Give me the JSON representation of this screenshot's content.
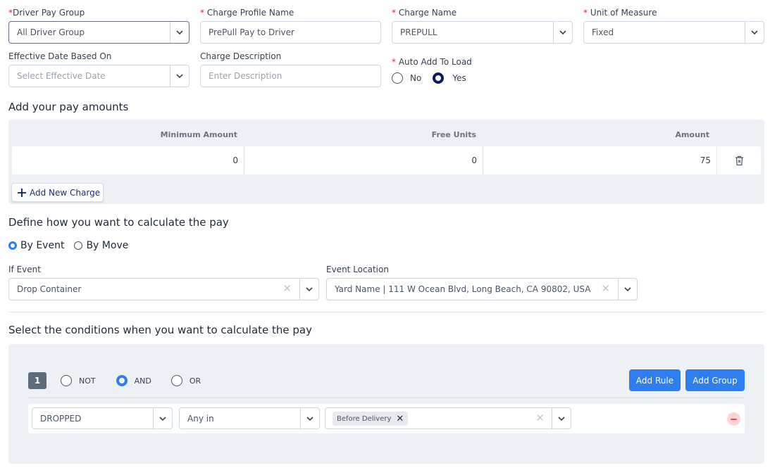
{
  "top_fields": {
    "driver_pay_group": {
      "required_mark": "*",
      "label": "Driver Pay Group",
      "value": "All Driver Group"
    },
    "charge_profile_name": {
      "required_mark": "* ",
      "label": "Charge Profile Name",
      "value": "PrePull Pay to Driver"
    },
    "charge_name": {
      "required_mark": "* ",
      "label": "Charge Name",
      "value": "PREPULL"
    },
    "unit_of_measure": {
      "required_mark": "* ",
      "label": "Unit of Measure",
      "value": "Fixed"
    },
    "effective_date": {
      "label": "Effective Date Based On",
      "placeholder": "Select Effective Date"
    },
    "charge_description": {
      "label": "Charge Description",
      "placeholder": "Enter Description"
    },
    "auto_add": {
      "required_mark": "* ",
      "label": "Auto Add To Load",
      "option_no": "No",
      "option_yes": "Yes",
      "selected": "Yes"
    }
  },
  "pay_amounts": {
    "title": "Add your pay amounts",
    "columns": [
      "Minimum Amount",
      "Free Units",
      "Amount"
    ],
    "rows": [
      {
        "minimum_amount": "0",
        "free_units": "0",
        "amount": "75"
      }
    ],
    "add_button": "Add New Charge"
  },
  "calculation": {
    "title": "Define how you want to calculate the pay",
    "option_event": "By Event",
    "option_move": "By Move",
    "selected": "By Event",
    "if_event": {
      "label": "If Event",
      "value": "Drop Container"
    },
    "event_location": {
      "label": "Event Location",
      "value": "Yard Name | 111 W Ocean Blvd, Long Beach, CA 90802, USA"
    }
  },
  "conditions": {
    "title": "Select the conditions when you want to calculate the pay",
    "group_number": "1",
    "logic_not": "NOT",
    "logic_and": "AND",
    "logic_or": "OR",
    "logic_selected": "AND",
    "add_rule": "Add Rule",
    "add_group": "Add Group",
    "rule": {
      "field": "DROPPED",
      "operator": "Any in",
      "chips": [
        "Before Delivery"
      ]
    }
  },
  "colors": {
    "primary": "#2f7ef0",
    "radio_dark": "#0b1b5c",
    "panel_bg": "#edf1f5",
    "required": "#e11d48",
    "remove": "#fca5a5"
  },
  "icons": [
    "chevron-down-icon",
    "clear-icon",
    "trash-icon",
    "plus-icon",
    "remove-icon"
  ]
}
